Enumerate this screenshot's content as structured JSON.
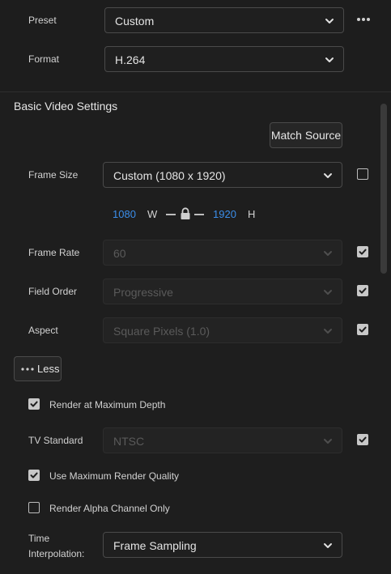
{
  "top": {
    "preset_label": "Preset",
    "preset_value": "Custom",
    "format_label": "Format",
    "format_value": "H.264"
  },
  "basic_video": {
    "title": "Basic Video Settings",
    "match_source": "Match Source",
    "frame_size_label": "Frame Size",
    "frame_size_value": "Custom (1080 x 1920)",
    "frame_size_checked": false,
    "width_value": "1080",
    "width_unit": "W",
    "height_value": "1920",
    "height_unit": "H",
    "frame_rate_label": "Frame Rate",
    "frame_rate_value": "60",
    "frame_rate_checked": true,
    "field_order_label": "Field Order",
    "field_order_value": "Progressive",
    "field_order_checked": true,
    "aspect_label": "Aspect",
    "aspect_value": "Square Pixels (1.0)",
    "aspect_checked": true,
    "less_label": "Less",
    "render_max_depth_label": "Render at Maximum Depth",
    "render_max_depth_checked": true,
    "tv_standard_label": "TV Standard",
    "tv_standard_value": "NTSC",
    "tv_standard_checked": true,
    "max_render_quality_label": "Use Maximum Render Quality",
    "max_render_quality_checked": true,
    "alpha_only_label": "Render Alpha Channel Only",
    "alpha_only_checked": false,
    "time_interp_label_line1": "Time",
    "time_interp_label_line2": "Interpolation:",
    "time_interp_value": "Frame Sampling"
  },
  "icons": [
    "more-icon",
    "chevron-down-icon",
    "lock-icon",
    "checkmark-icon"
  ],
  "colors": {
    "accent_blue": "#3b8eea",
    "background": "#1d1d1d",
    "border": "#4a4a4a"
  }
}
